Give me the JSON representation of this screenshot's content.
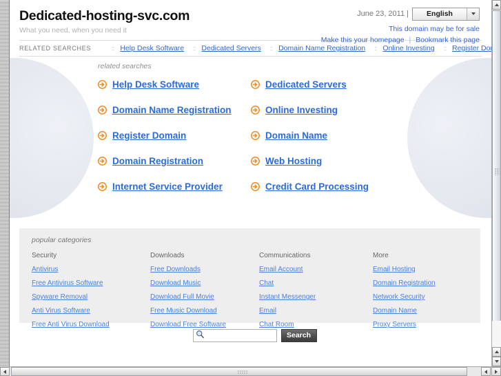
{
  "header": {
    "site_title": "Dedicated-hosting-svc.com",
    "tagline": "What you need, when you need it",
    "date": "June 23, 2011 |",
    "language": "English",
    "language_arrow_icon": "chevron-down-icon",
    "for_sale_link": "This domain may be for sale",
    "homepage_link": "Make this your homepage",
    "separator": "|",
    "bookmark_link": "Bookmark this page"
  },
  "related_bar": {
    "label": "RELATED SEARCHES",
    "dots": "::",
    "links": [
      "Help Desk Software",
      "Dedicated Servers",
      "Domain Name Registration",
      "Online Investing",
      "Register Domain"
    ]
  },
  "hero": {
    "caption": "related searches",
    "arrow_icon": "arrow-right-circle-icon",
    "links": [
      "Help Desk Software",
      "Dedicated Servers",
      "Domain Name Registration",
      "Online Investing",
      "Register Domain",
      "Domain Name",
      "Domain Registration",
      "Web Hosting",
      "Internet Service Provider",
      "Credit Card Processing"
    ]
  },
  "categories": {
    "title": "popular categories",
    "columns": [
      {
        "heading": "Security",
        "links": [
          "Antivirus",
          "Free Antivirus Software",
          "Spyware Removal",
          "Anti Virus Software",
          "Free Anti Virus Download"
        ]
      },
      {
        "heading": "Downloads",
        "links": [
          "Free Downloads",
          "Download Music",
          "Download Full Movie",
          "Free Music Download",
          "Download Free Software"
        ]
      },
      {
        "heading": "Communications",
        "links": [
          "Email Account",
          "Chat",
          "Instant Messenger",
          "Email",
          "Chat Room"
        ]
      },
      {
        "heading": "More",
        "links": [
          "Email Hosting",
          "Domain Registration",
          "Network Security",
          "Domain Name",
          "Proxy Servers"
        ]
      }
    ]
  },
  "search": {
    "value": "",
    "placeholder": "",
    "magnifier_icon": "search-icon",
    "button_label": "Search"
  },
  "scrollbars": {
    "up_icon": "triangle-up-icon",
    "down_icon": "triangle-down-icon",
    "left_icon": "triangle-left-icon",
    "right_icon": "triangle-right-icon"
  },
  "colors": {
    "link_blue": "#3366cc",
    "hero_link_blue": "#2a6ae0",
    "accent_orange": "#f08a1e",
    "panel_grey": "#eeeeee"
  }
}
